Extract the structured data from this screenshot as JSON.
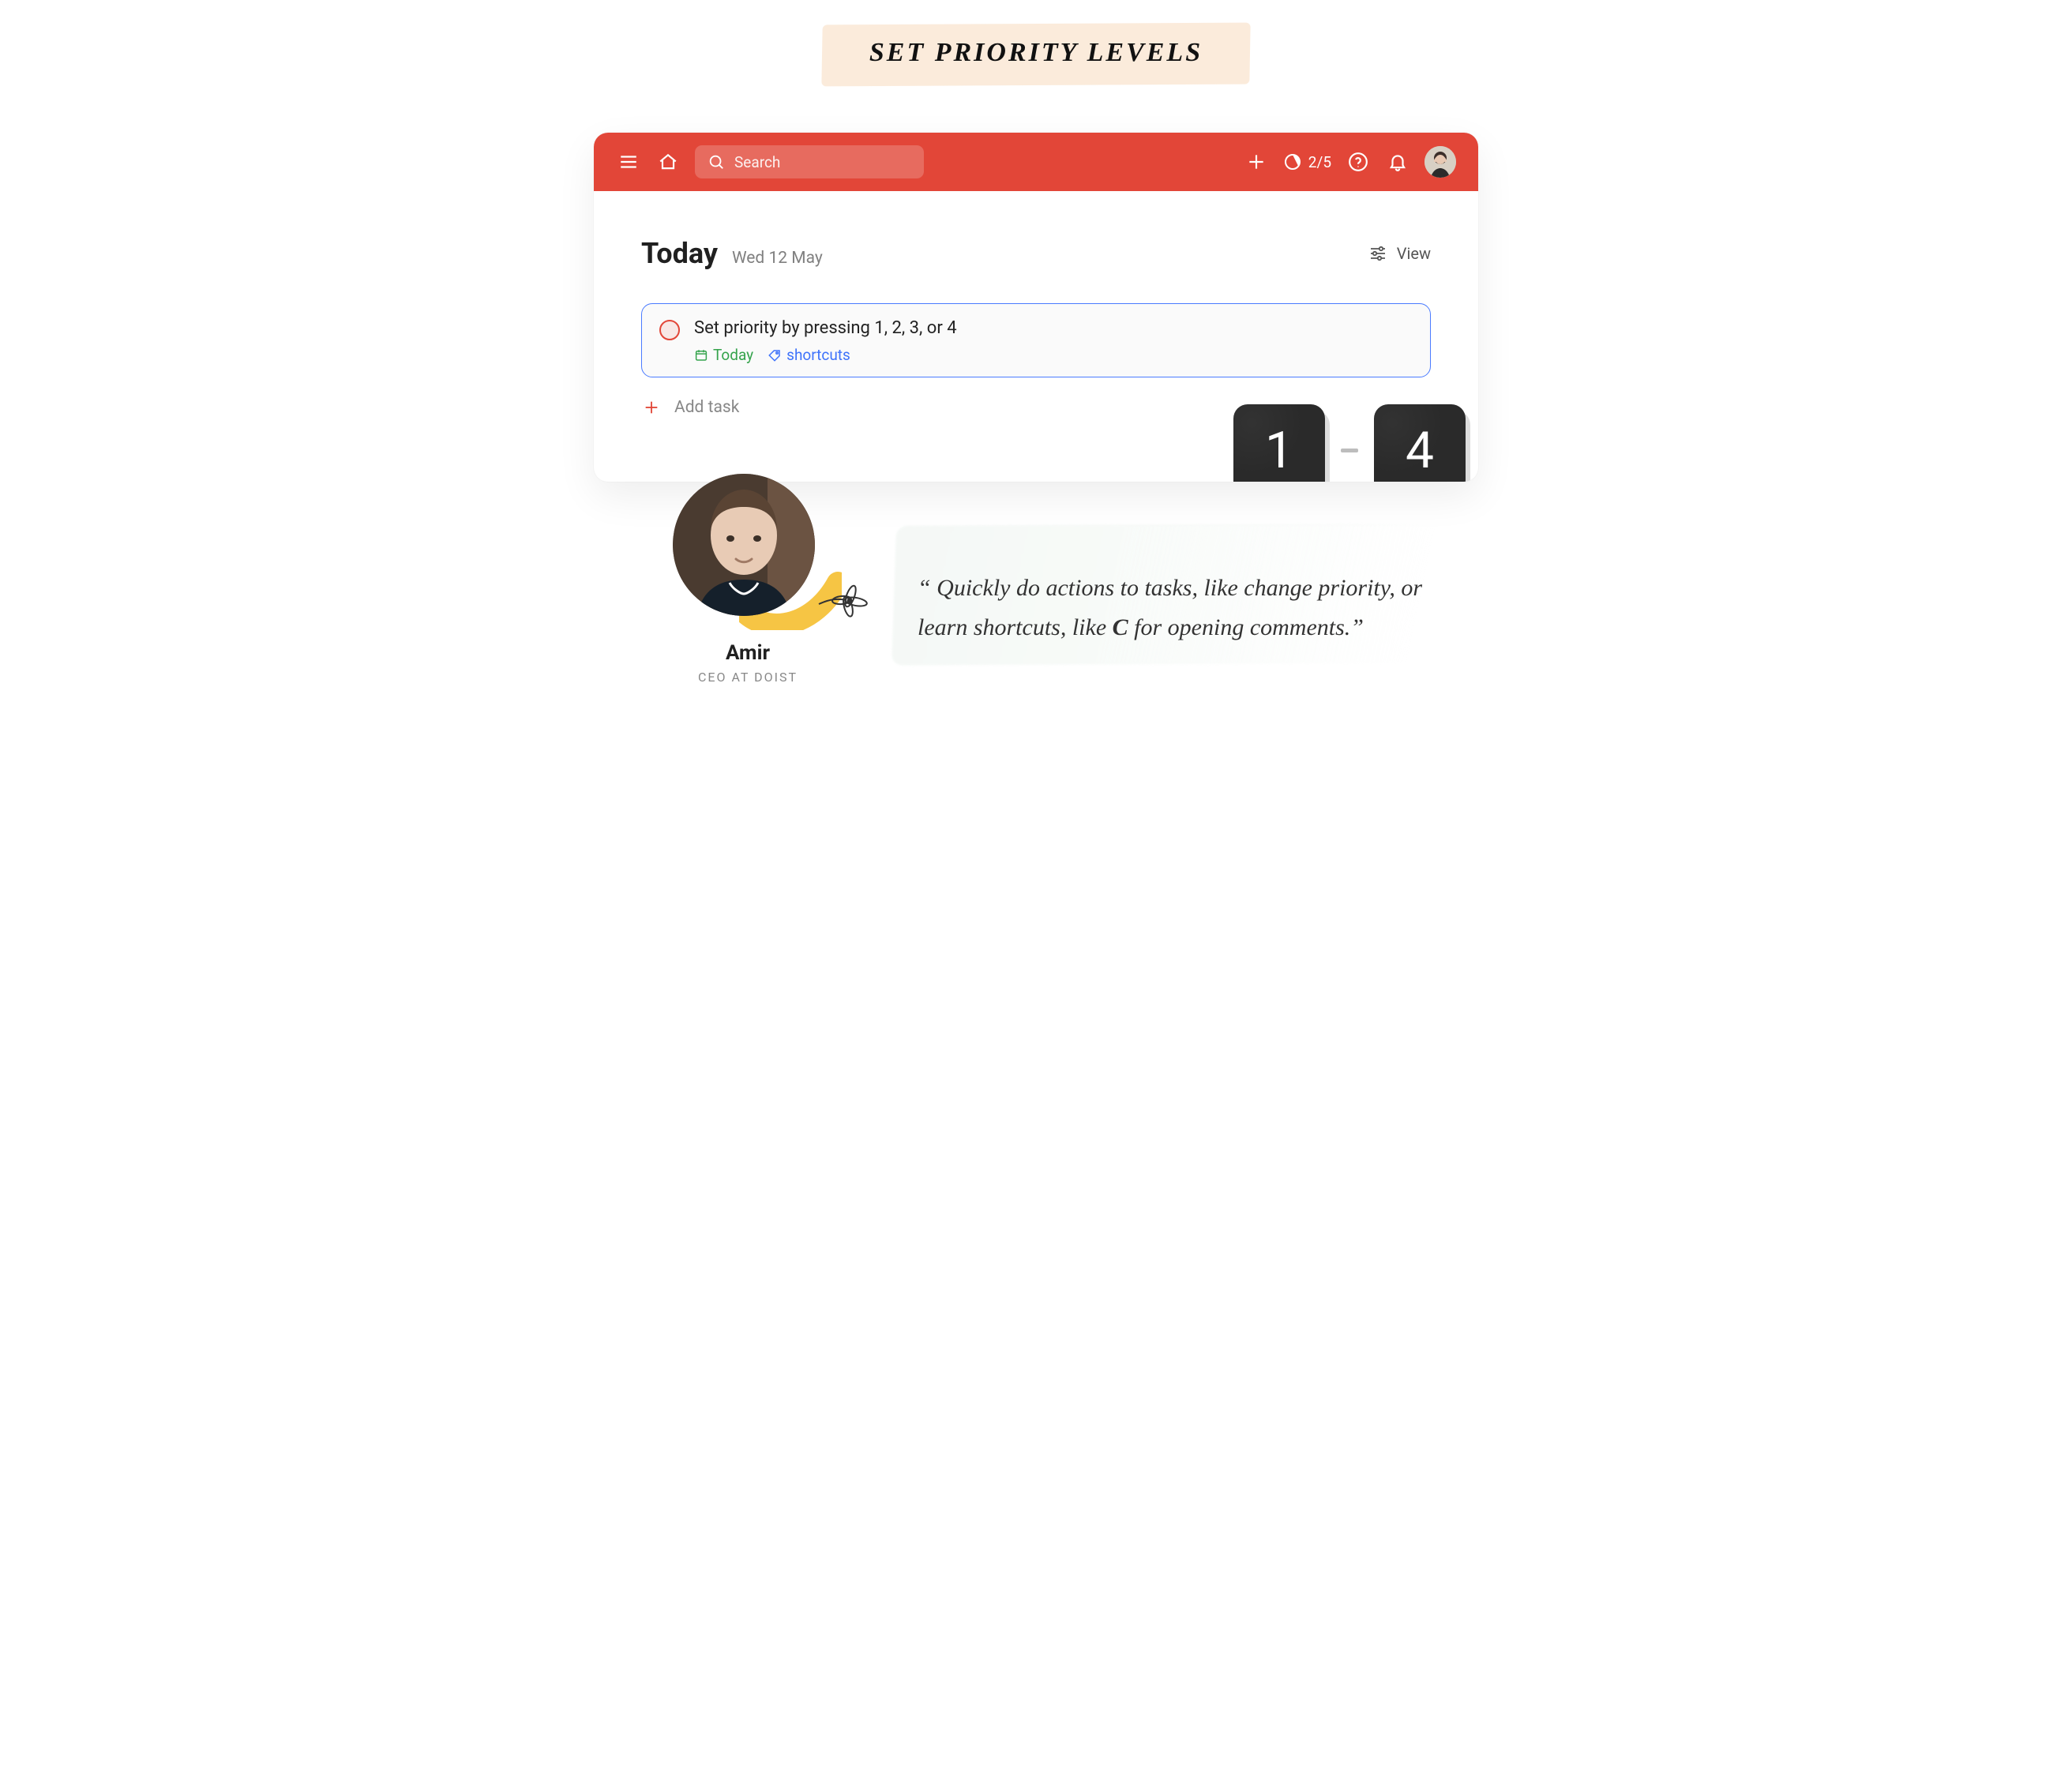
{
  "banner": {
    "title": "Set Priority Levels"
  },
  "topbar": {
    "search_placeholder": "Search",
    "progress": "2/5"
  },
  "page": {
    "title": "Today",
    "date": "Wed 12 May",
    "view_label": "View"
  },
  "task": {
    "title": "Set priority by pressing 1, 2, 3, or 4",
    "date_label": "Today",
    "tag": "shortcuts"
  },
  "add_task_label": "Add task",
  "keys": {
    "from": "1",
    "to": "4"
  },
  "person": {
    "name": "Amir",
    "role": "CEO at Doist"
  },
  "quote": {
    "before": "“ Quickly do actions to tasks, like change priority, or learn shortcuts, like ",
    "bold": "C",
    "after": " for opening comments.”"
  }
}
